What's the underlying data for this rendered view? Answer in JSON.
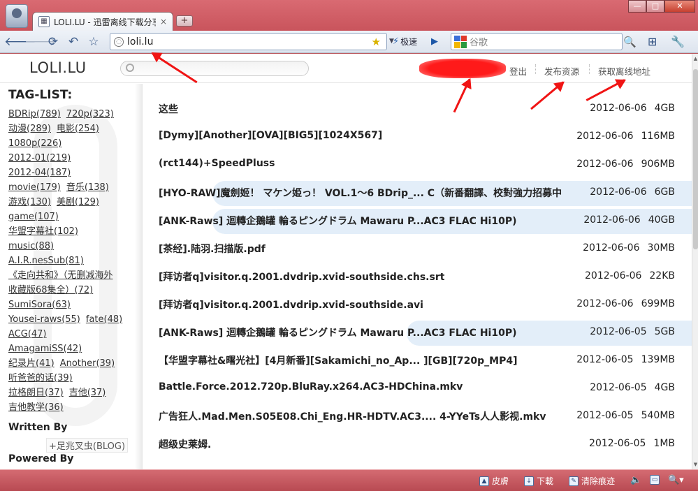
{
  "browser": {
    "tab_title": "LOLI.LU - 迅雷离线下载分享",
    "tab_close": "×",
    "new_tab": "+",
    "window_buttons": [
      "—",
      "□",
      "✕"
    ],
    "address": "loli.lu",
    "speed_label": "极速",
    "search_placeholder": "谷歌",
    "icons": [
      "back-icon",
      "forward-icon",
      "reload-icon",
      "undo-icon",
      "bookmark-star-icon"
    ]
  },
  "site": {
    "logo": "LOLI.LU",
    "nav": {
      "logout": "登出",
      "publish": "发布资源",
      "get_link": "获取离线地址"
    }
  },
  "sidebar": {
    "title": "TAG-LIST:",
    "tag_rows": [
      [
        "BDRip(789)",
        "720p(323)"
      ],
      [
        "动漫(289)",
        "电影(254)"
      ],
      [
        "1080p(226)"
      ],
      [
        "2012-01(219)"
      ],
      [
        "2012-04(187)"
      ],
      [
        "movie(179)",
        "音乐(138)"
      ],
      [
        "游戏(130)",
        "美剧(129)"
      ],
      [
        "game(107)"
      ],
      [
        "华盟字幕社(102)"
      ],
      [
        "music(88)"
      ],
      [
        "A.I.R.nesSub(81)"
      ],
      [
        "《走向共和》（无删减海外"
      ],
      [
        "收藏版68集全）(72)"
      ],
      [
        "SumiSora(63)"
      ],
      [
        "Yousei-raws(55)",
        "fate(48)"
      ],
      [
        "ACG(47)"
      ],
      [
        "AmagamiSS(42)"
      ],
      [
        "纪录片(41)",
        "Another(39)"
      ],
      [
        "听爸爸的话(39)"
      ],
      [
        "拉格朗日(37)",
        "吉他(37)"
      ],
      [
        "吉他教学(36)"
      ]
    ],
    "written_by": "Written By",
    "blog_link": "+足兆叉虫(BLOG)",
    "powered_by": "Powered By"
  },
  "files": [
    {
      "title": "这些",
      "date": "2012-06-06",
      "size": "4GB",
      "highlight": false
    },
    {
      "title": "[Dymy][Another][OVA][BIG5][1024X567]",
      "date": "2012-06-06",
      "size": "116MB",
      "highlight": false
    },
    {
      "title": "(rct144)+SpeedPluss",
      "date": "2012-06-06",
      "size": "906MB",
      "highlight": false
    },
    {
      "title": "[HYO-RAW]魔劍姬！ マケン姫っ！ VOL.1～6 BDrip_... C（新番翻譯、校對強力招募中",
      "date": "2012-06-06",
      "size": "6GB",
      "highlight": true
    },
    {
      "title": "[ANK-Raws] 迴轉企鵝罐 輪るピングドラム Mawaru P...AC3 FLAC Hi10P)",
      "date": "2012-06-06",
      "size": "40GB",
      "highlight": true
    },
    {
      "title": "[茶经].陆羽.扫描版.pdf",
      "date": "2012-06-06",
      "size": "30MB",
      "highlight": false
    },
    {
      "title": "[拜访者q]visitor.q.2001.dvdrip.xvid-southside.chs.srt",
      "date": "2012-06-06",
      "size": "22KB",
      "highlight": false
    },
    {
      "title": "[拜访者q]visitor.q.2001.dvdrip.xvid-southside.avi",
      "date": "2012-06-06",
      "size": "699MB",
      "highlight": false
    },
    {
      "title": "[ANK-Raws] 迴轉企鵝罐 輪るピングドラム Mawaru P...AC3 FLAC Hi10P)",
      "date": "2012-06-05",
      "size": "5GB",
      "highlight": true
    },
    {
      "title": "【华盟字幕社&曙光社】[4月新番][Sakamichi_no_Ap... ][GB][720p_MP4]",
      "date": "2012-06-05",
      "size": "139MB",
      "highlight": false
    },
    {
      "title": "Battle.Force.2012.720p.BluRay.x264.AC3-HDChina.mkv",
      "date": "2012-06-05",
      "size": "4GB",
      "highlight": false
    },
    {
      "title": "广告狂人.Mad.Men.S05E08.Chi_Eng.HR-HDTV.AC3.... 4-YYeTs人人影视.mkv",
      "date": "2012-06-05",
      "size": "540MB",
      "highlight": false
    },
    {
      "title": "超级史莱姆.",
      "date": "2012-06-05",
      "size": "1MB",
      "highlight": false
    }
  ],
  "statusbar": {
    "skin": "皮膚",
    "download": "下載",
    "clear": "清除痕迹"
  },
  "colors": {
    "chrome": "#c9545c",
    "highlight_row": "#e3eef9",
    "arrow": "#f01414"
  }
}
